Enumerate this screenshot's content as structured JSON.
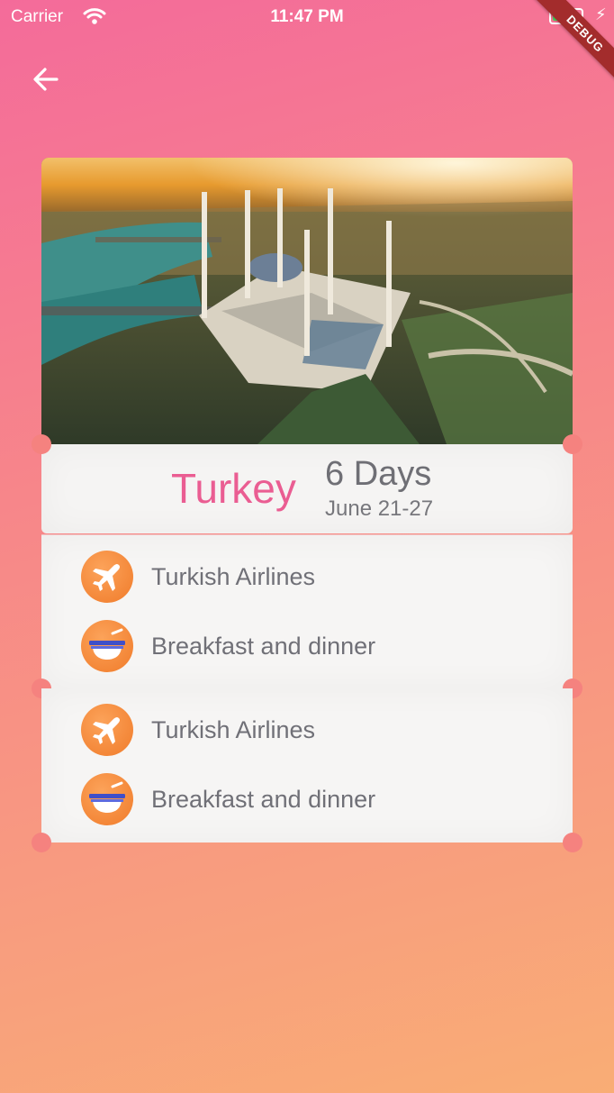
{
  "status_bar": {
    "carrier": "Carrier",
    "time": "11:47 PM",
    "battery_level": 0.9
  },
  "debug_banner": "DEBUG",
  "navigation": {
    "back_icon": "arrow-left-icon"
  },
  "trip": {
    "country": "Turkey",
    "duration": "6 Days",
    "dates": "June 21-27",
    "photo_subject": "mosque-aerial-view-photo"
  },
  "sections": [
    {
      "items": [
        {
          "icon": "airplane-icon",
          "label": "Turkish Airlines"
        },
        {
          "icon": "bowl-icon",
          "label": "Breakfast and dinner"
        }
      ]
    },
    {
      "items": [
        {
          "icon": "airplane-icon",
          "label": "Turkish Airlines"
        },
        {
          "icon": "bowl-icon",
          "label": "Breakfast and dinner"
        }
      ]
    }
  ],
  "colors": {
    "accent": "#ea5d92",
    "icon_orange": "#f07b2a",
    "card_background": "#f5f4f3"
  }
}
